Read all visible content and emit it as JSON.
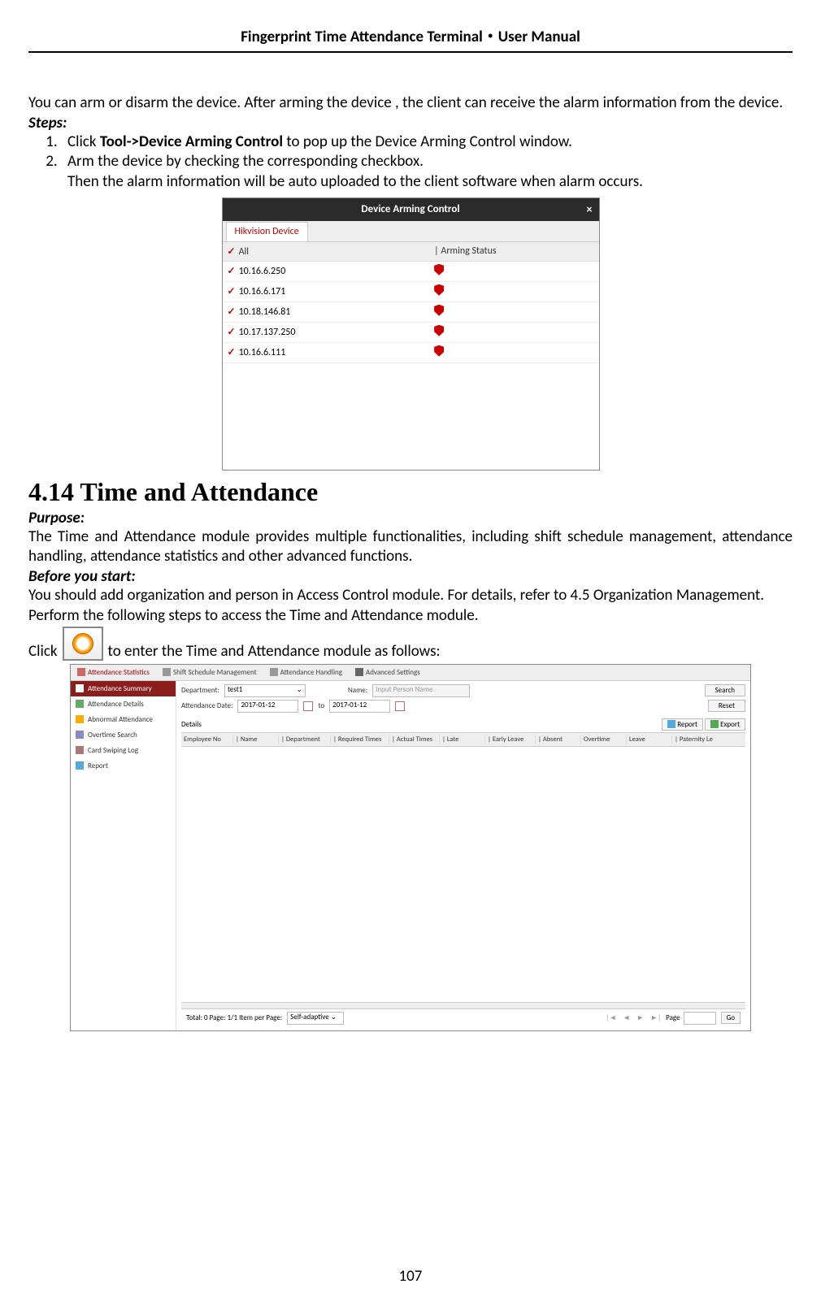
{
  "header": {
    "title": "Fingerprint Time Attendance Terminal・User Manual"
  },
  "intro": "You can arm or disarm the device. After arming the device , the client can receive the alarm information from the device.",
  "steps_label": "Steps:",
  "steps": {
    "s1_prefix": "Click ",
    "s1_bold": "Tool->Device Arming Control",
    "s1_suffix": " to pop up the Device Arming Control window.",
    "s2": "Arm the device by checking the corresponding checkbox.",
    "s2_cont": "Then the alarm information will be auto uploaded to the client software when alarm occurs."
  },
  "arming": {
    "title": "Device Arming Control",
    "tab": "Hikvision Device",
    "col_all": "All",
    "col_status": "Arming Status",
    "rows": [
      "10.16.6.250",
      "10.16.6.171",
      "10.18.146.81",
      "10.17.137.250",
      "10.16.6.111"
    ]
  },
  "section": {
    "heading": "4.14 Time and Attendance"
  },
  "purpose_label": "Purpose:",
  "purpose": "The Time and Attendance module provides multiple functionalities, including shift schedule management, attendance handling, attendance statistics and other advanced functions.",
  "before_label": "Before you start:",
  "before": "You should add organization and person in Access Control module. For details, refer to 4.5 Organization Management.",
  "perform": "Perform the following steps to access the Time and Attendance module.",
  "click_prefix": "Click",
  "click_suffix": " to enter the Time and Attendance module as follows:",
  "ta": {
    "tabs": [
      "Attendance Statistics",
      "Shift Schedule Management",
      "Attendance Handling",
      "Advanced Settings"
    ],
    "sidebar": [
      "Attendance Summary",
      "Attendance Details",
      "Abnormal Attendance",
      "Overtime Search",
      "Card Swiping Log",
      "Report"
    ],
    "filter": {
      "dept_label": "Department:",
      "dept_val": "test1",
      "name_label": "Name:",
      "name_placeholder": "Input Person Name",
      "date_label": "Attendance Date:",
      "date_from": "2017-01-12",
      "date_to_label": "to",
      "date_to": "2017-01-12",
      "search": "Search",
      "reset": "Reset"
    },
    "details_label": "Details",
    "report_btn": "Report",
    "export_btn": "Export",
    "columns": [
      "Employee No",
      "Name",
      "Department",
      "Required Times",
      "Actual Times",
      "Late",
      "Early Leave",
      "Absent",
      "Overtime",
      "Leave",
      "Paternity Le"
    ],
    "footer": {
      "total": "Total: 0  Page: 1/1  Item per Page:",
      "self_adaptive": "Self-adaptive",
      "page_label": "Page",
      "go": "Go"
    }
  },
  "page_number": "107"
}
